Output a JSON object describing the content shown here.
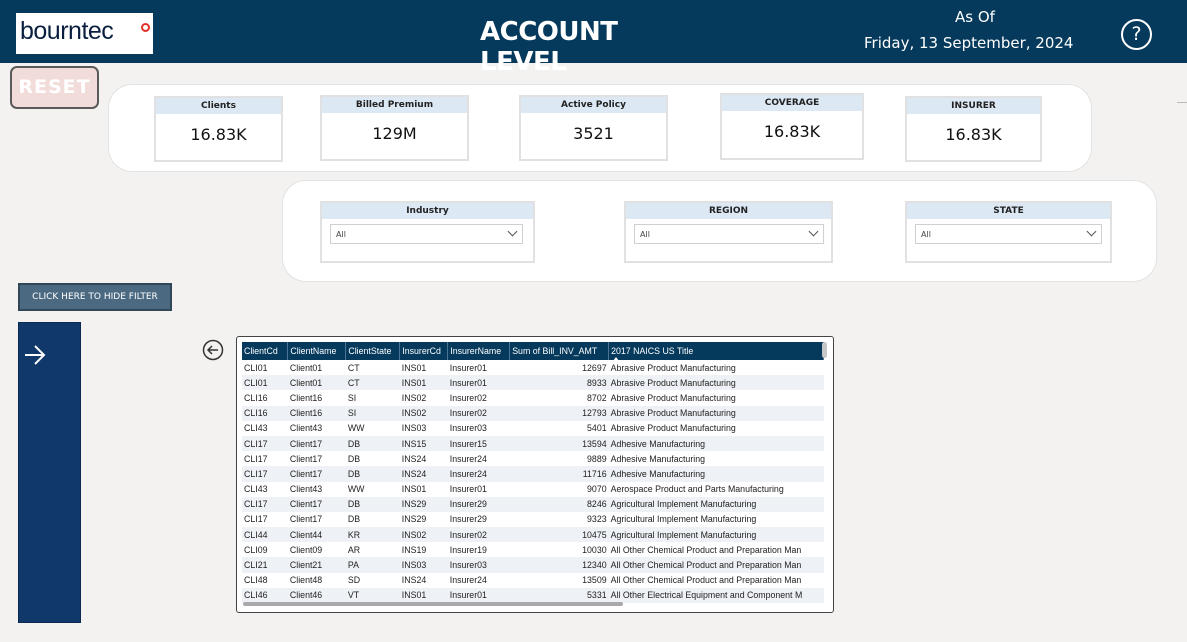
{
  "header": {
    "logo_text": "bourntec",
    "title": "ACCOUNT LEVEL",
    "as_of_label": "As Of",
    "as_of_date": "Friday, 13 September, 2024",
    "help_glyph": "?",
    "bg_color": "#053a5c"
  },
  "reset_label": "RESET",
  "kpis": [
    {
      "label": "Clients",
      "value": "16.83K"
    },
    {
      "label": "Billed Premium",
      "value": "129M"
    },
    {
      "label": "Active Policy",
      "value": "3521"
    },
    {
      "label": "COVERAGE",
      "value": "16.83K"
    },
    {
      "label": "INSURER",
      "value": "16.83K"
    }
  ],
  "filters": [
    {
      "label": "Industry",
      "value": "All"
    },
    {
      "label": "REGION",
      "value": "All"
    },
    {
      "label": "STATE",
      "value": "All"
    }
  ],
  "hide_filter_label": "CLICK HERE TO HIDE FILTER",
  "icons": {
    "side_arrow": "arrow-right-icon",
    "back_arrow": "arrow-left-circle-icon",
    "help": "question-circle-icon",
    "dropdown": "chevron-down-icon"
  },
  "table": {
    "columns": [
      "ClientCd",
      "ClientName",
      "ClientState",
      "InsurerCd",
      "InsurerName",
      "Sum of Bill_INV_AMT",
      "2017 NAICS US Title"
    ],
    "rows": [
      [
        "CLI01",
        "Client01",
        "CT",
        "INS01",
        "Insurer01",
        "12697",
        "Abrasive Product Manufacturing"
      ],
      [
        "CLI01",
        "Client01",
        "CT",
        "INS01",
        "Insurer01",
        "8933",
        "Abrasive Product Manufacturing"
      ],
      [
        "CLI16",
        "Client16",
        "SI",
        "INS02",
        "Insurer02",
        "8702",
        "Abrasive Product Manufacturing"
      ],
      [
        "CLI16",
        "Client16",
        "SI",
        "INS02",
        "Insurer02",
        "12793",
        "Abrasive Product Manufacturing"
      ],
      [
        "CLI43",
        "Client43",
        "WW",
        "INS03",
        "Insurer03",
        "5401",
        "Abrasive Product Manufacturing"
      ],
      [
        "CLI17",
        "Client17",
        "DB",
        "INS15",
        "Insurer15",
        "13594",
        "Adhesive Manufacturing"
      ],
      [
        "CLI17",
        "Client17",
        "DB",
        "INS24",
        "Insurer24",
        "9889",
        "Adhesive Manufacturing"
      ],
      [
        "CLI17",
        "Client17",
        "DB",
        "INS24",
        "Insurer24",
        "11716",
        "Adhesive Manufacturing"
      ],
      [
        "CLI43",
        "Client43",
        "WW",
        "INS01",
        "Insurer01",
        "9070",
        "Aerospace Product and Parts Manufacturing"
      ],
      [
        "CLI17",
        "Client17",
        "DB",
        "INS29",
        "Insurer29",
        "8246",
        "Agricultural Implement Manufacturing"
      ],
      [
        "CLI17",
        "Client17",
        "DB",
        "INS29",
        "Insurer29",
        "9323",
        "Agricultural Implement Manufacturing"
      ],
      [
        "CLI44",
        "Client44",
        "KR",
        "INS02",
        "Insurer02",
        "10475",
        "Agricultural Implement Manufacturing"
      ],
      [
        "CLI09",
        "Client09",
        "AR",
        "INS19",
        "Insurer19",
        "10030",
        "All Other Chemical Product and Preparation Man"
      ],
      [
        "CLI21",
        "Client21",
        "PA",
        "INS03",
        "Insurer03",
        "12340",
        "All Other Chemical Product and Preparation Man"
      ],
      [
        "CLI48",
        "Client48",
        "SD",
        "INS24",
        "Insurer24",
        "13509",
        "All Other Chemical Product and Preparation Man"
      ],
      [
        "CLI46",
        "Client46",
        "VT",
        "INS01",
        "Insurer01",
        "5331",
        "All Other Electrical Equipment and Component M"
      ]
    ]
  }
}
